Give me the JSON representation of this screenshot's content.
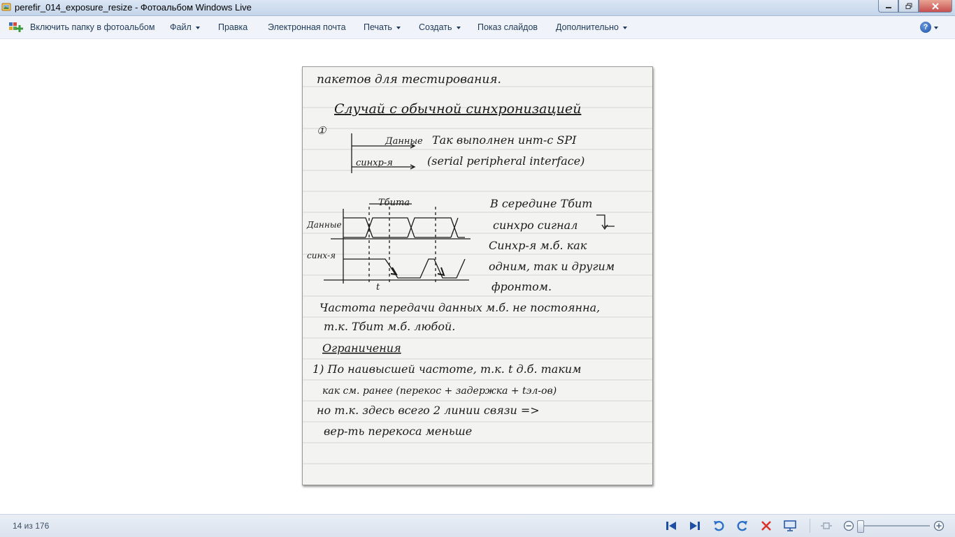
{
  "window": {
    "title": "perefir_014_exposure_resize - Фотоальбом Windows Live",
    "icon": "photo-gallery-icon"
  },
  "menu": {
    "add_folder": "Включить папку в фотоальбом",
    "file": "Файл",
    "edit": "Правка",
    "email": "Электронная почта",
    "print": "Печать",
    "create": "Создать",
    "slideshow": "Показ слайдов",
    "extras": "Дополнительно",
    "help_glyph": "?"
  },
  "status": {
    "counter": "14 из 176"
  },
  "colors": {
    "accent": "#1d4fa6",
    "close": "#c75050",
    "rotate": "#2a6fc9",
    "delete": "#d9342b"
  },
  "note": {
    "lines": [
      "пакетов для тестирования.",
      "Случай с обычной синхронизацией",
      "①",
      "Данные",
      "синхр-я",
      "Так выполнен инт-с SPI",
      "(serial peripheral interface)",
      "Тбита",
      "Данные",
      "синх-я",
      "t",
      "В середине Тбит",
      "синхро сигнал",
      "Синхр-я м.б. как",
      "одним, так и другим",
      "фронтом.",
      "Частота передачи данных м.б. не постоянна,",
      "т.к. Тбит м.б. любой.",
      "Ограничения",
      "1) По наивысшей частоте, т.к. t д.б. таким",
      "как см. ранее (перекос + задержка + tэл-ов)",
      "но т.к. здесь всего 2 линии связи =>",
      "вер-ть перекоса меньше"
    ]
  }
}
